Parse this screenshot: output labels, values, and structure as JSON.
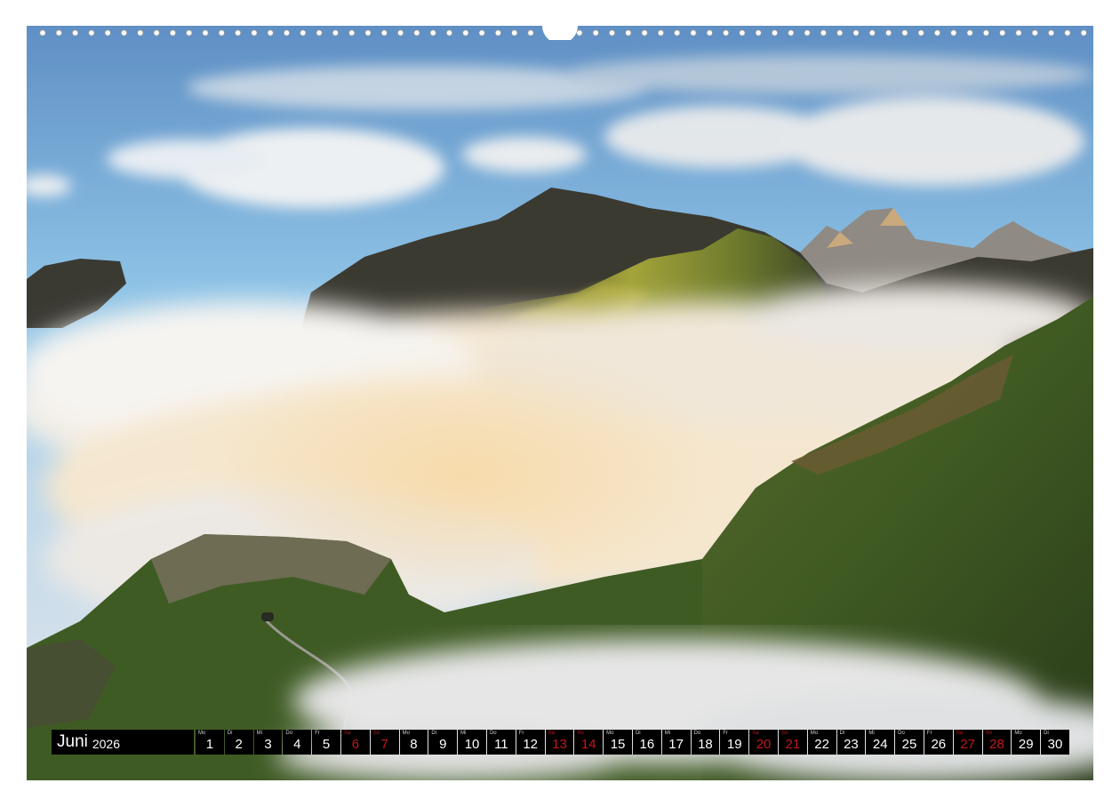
{
  "calendar": {
    "month": "Juni",
    "year": "2026",
    "days": [
      {
        "wd": "Mo",
        "num": "1",
        "weekend": false
      },
      {
        "wd": "Di",
        "num": "2",
        "weekend": false
      },
      {
        "wd": "Mi",
        "num": "3",
        "weekend": false
      },
      {
        "wd": "Do",
        "num": "4",
        "weekend": false
      },
      {
        "wd": "Fr",
        "num": "5",
        "weekend": false
      },
      {
        "wd": "Sa",
        "num": "6",
        "weekend": true
      },
      {
        "wd": "So",
        "num": "7",
        "weekend": true
      },
      {
        "wd": "Mo",
        "num": "8",
        "weekend": false
      },
      {
        "wd": "Di",
        "num": "9",
        "weekend": false
      },
      {
        "wd": "Mi",
        "num": "10",
        "weekend": false
      },
      {
        "wd": "Do",
        "num": "11",
        "weekend": false
      },
      {
        "wd": "Fr",
        "num": "12",
        "weekend": false
      },
      {
        "wd": "Sa",
        "num": "13",
        "weekend": true
      },
      {
        "wd": "So",
        "num": "14",
        "weekend": true
      },
      {
        "wd": "Mo",
        "num": "15",
        "weekend": false
      },
      {
        "wd": "Di",
        "num": "16",
        "weekend": false
      },
      {
        "wd": "Mi",
        "num": "17",
        "weekend": false
      },
      {
        "wd": "Do",
        "num": "18",
        "weekend": false
      },
      {
        "wd": "Fr",
        "num": "19",
        "weekend": false
      },
      {
        "wd": "Sa",
        "num": "20",
        "weekend": true
      },
      {
        "wd": "So",
        "num": "21",
        "weekend": true
      },
      {
        "wd": "Mo",
        "num": "22",
        "weekend": false
      },
      {
        "wd": "Di",
        "num": "23",
        "weekend": false
      },
      {
        "wd": "Mi",
        "num": "24",
        "weekend": false
      },
      {
        "wd": "Do",
        "num": "25",
        "weekend": false
      },
      {
        "wd": "Fr",
        "num": "26",
        "weekend": false
      },
      {
        "wd": "Sa",
        "num": "27",
        "weekend": true
      },
      {
        "wd": "So",
        "num": "28",
        "weekend": true
      },
      {
        "wd": "Mo",
        "num": "29",
        "weekend": false
      },
      {
        "wd": "Di",
        "num": "30",
        "weekend": false
      }
    ]
  },
  "colors": {
    "weekend": "#c4161c",
    "calendar_bg": "#000000",
    "sky": "#7fb3dc",
    "grass": "#4a6b2a"
  }
}
